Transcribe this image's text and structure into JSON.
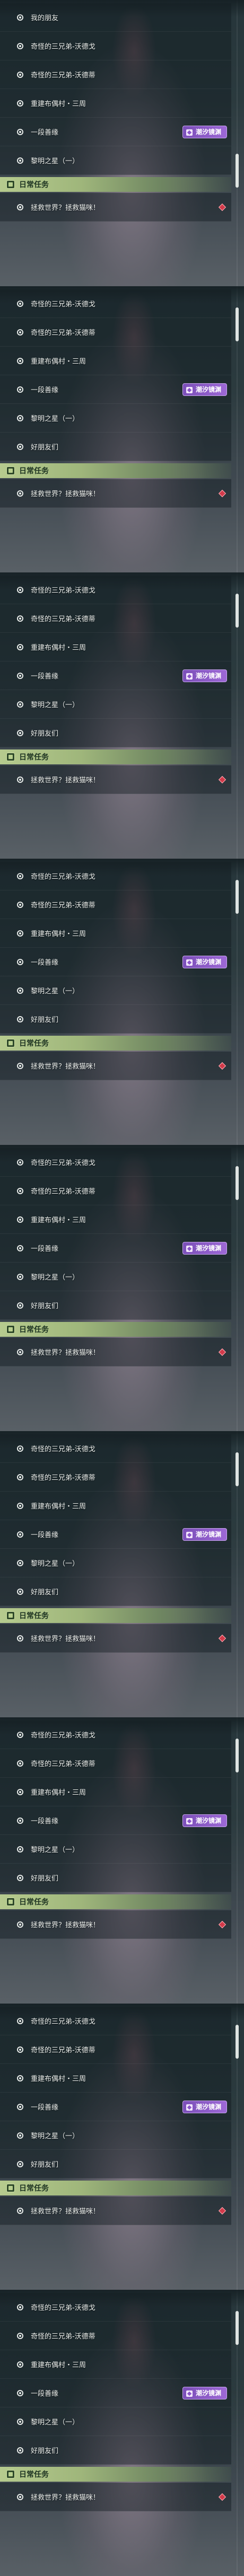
{
  "first_panel": {
    "top_item": "我的朋友",
    "quests": [
      "奇怪的三兄弟-沃德戈",
      "奇怪的三兄弟-沃德蒂",
      "重建布偶村・三周",
      "一段善缘",
      "黎明之星（一）"
    ]
  },
  "repeated_panel": {
    "quests": [
      "奇怪的三兄弟-沃德戈",
      "奇怪的三兄弟-沃德蒂",
      "重建布偶村・三周",
      "一段善缘",
      "黎明之星（一）",
      "好朋友们"
    ]
  },
  "section_header": "日常任务",
  "daily_quest": "拯救世界？拯救猫咪！",
  "badge_label": "潮汐镜渊",
  "panel_count": 9,
  "colors": {
    "header_green": "#b6cb8e",
    "badge_purple": "#8a55c8",
    "alert_red": "#d23a4a",
    "row_text": "#eef1ee"
  },
  "icons": {
    "bullet": "ring-bullet-icon",
    "header": "daily-task-icon",
    "badge": "event-badge-icon",
    "alert": "red-diamond-alert-icon"
  }
}
